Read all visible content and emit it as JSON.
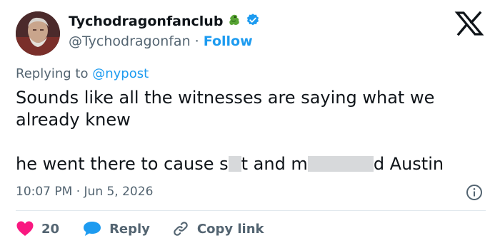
{
  "author": {
    "name": "Tychodragonfanclub",
    "handle": "@Tychodragonfan",
    "separator": "·",
    "follow_label": "Follow"
  },
  "reply": {
    "prefix": "Replying to",
    "mention": "@nypost"
  },
  "tweet": {
    "text": "Sounds like all the witnesses are saying what we already knew",
    "line2_part1": "he went there to cause s",
    "line2_part2": "t and m",
    "line2_part3": "d Austin"
  },
  "timestamp": "10:07 PM · Jun 5, 2026",
  "actions": {
    "likes": "20",
    "reply_label": "Reply",
    "copy_label": "Copy link"
  },
  "colors": {
    "accent": "#1d9bf0",
    "like": "#f91880",
    "text": "#0f1419",
    "secondary": "#536471"
  },
  "icons": [
    "avatar",
    "dragon-emoji-icon",
    "verified-badge-icon",
    "x-logo-icon",
    "info-icon",
    "heart-icon",
    "reply-bubble-icon",
    "link-icon"
  ]
}
